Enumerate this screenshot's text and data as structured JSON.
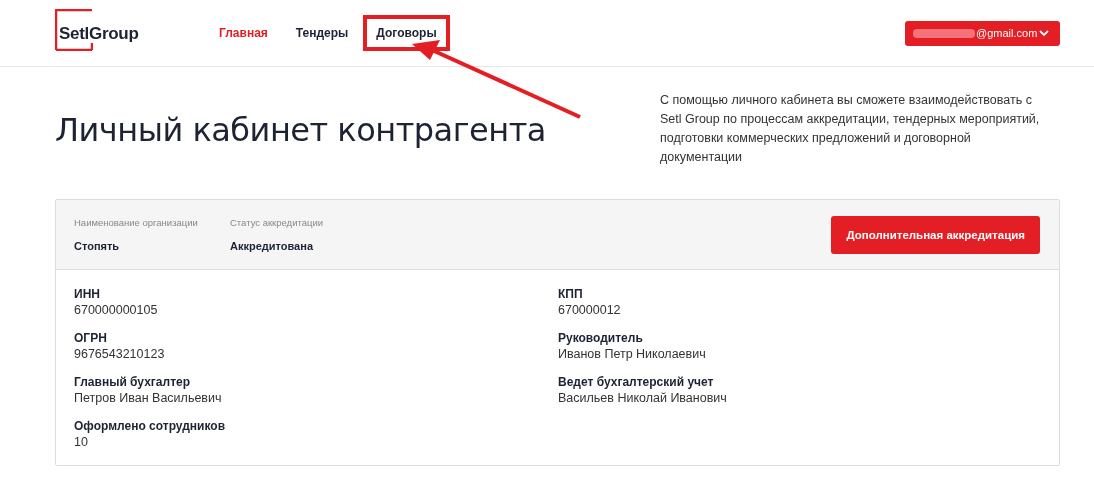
{
  "header": {
    "logo": "SetlGroup",
    "nav": [
      {
        "label": "Главная",
        "selected": true,
        "highlighted": false
      },
      {
        "label": "Тендеры",
        "selected": false,
        "highlighted": false
      },
      {
        "label": "Договоры",
        "selected": false,
        "highlighted": true
      }
    ],
    "account": {
      "email": "@gmail.com",
      "redacted": true
    }
  },
  "intro": {
    "title": "Личный кабинет контрагента",
    "description": "С помощью личного кабинета вы сможете взаимодействовать с Setl Group по процессам аккредитации, тендерных мероприятий, подготовки коммерческих предложений и договорной документации"
  },
  "card": {
    "summary": [
      {
        "label": "Наименование организации",
        "value": "Стопять"
      },
      {
        "label": "Статус аккредитации",
        "value": "Аккредитована"
      }
    ],
    "action": "Дополнительная аккредитация",
    "fields": [
      {
        "label": "ИНН",
        "value": "670000000105"
      },
      {
        "label": "КПП",
        "value": "670000012"
      },
      {
        "label": "ОГРН",
        "value": "9676543210123"
      },
      {
        "label": "Руководитель",
        "value": "Иванов Петр Николаевич"
      },
      {
        "label": "Главный бухгалтер",
        "value": "Петров Иван Васильевич"
      },
      {
        "label": "Ведет бухгалтерский учет",
        "value": "Васильев Николай Иванович"
      },
      {
        "label": "Оформлено сотрудников",
        "value": "10"
      }
    ]
  }
}
